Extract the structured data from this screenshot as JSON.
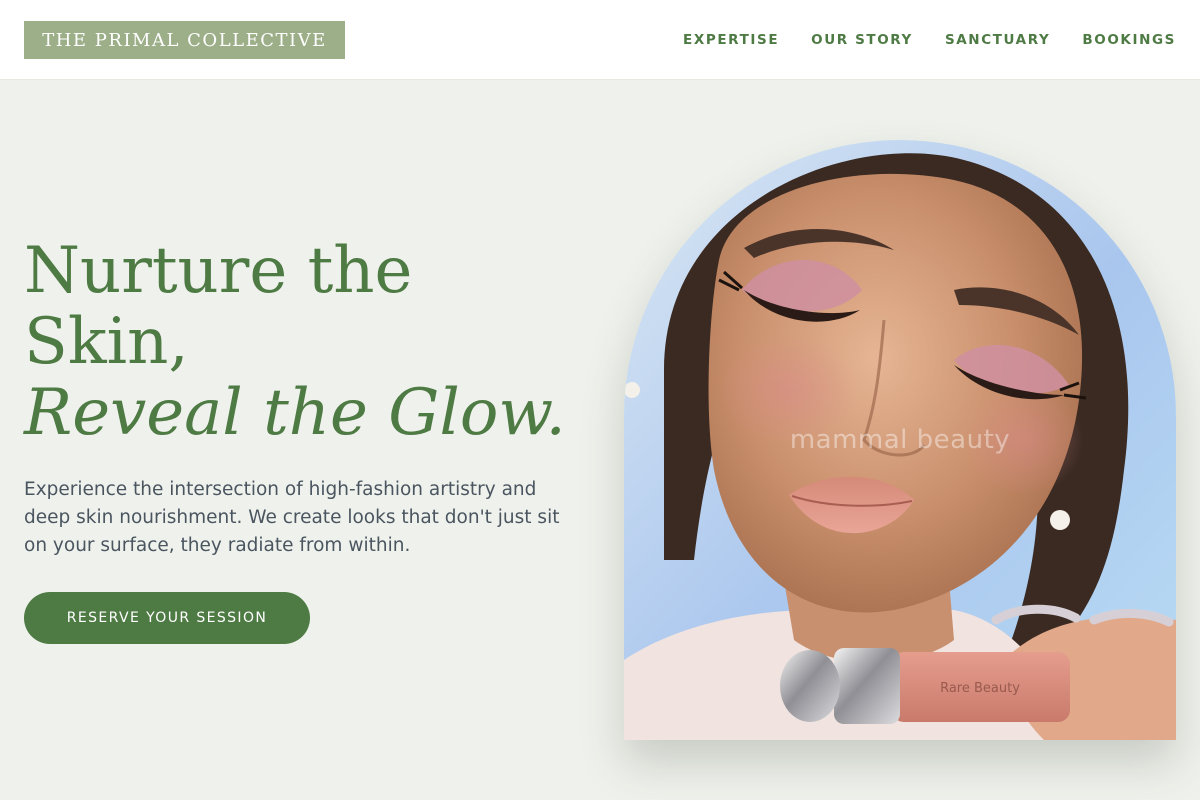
{
  "brand": {
    "logo_text": "THE PRIMAL COLLECTIVE"
  },
  "nav": {
    "items": [
      {
        "label": "EXPERTISE"
      },
      {
        "label": "OUR STORY"
      },
      {
        "label": "SANCTUARY"
      },
      {
        "label": "BOOKINGS"
      }
    ]
  },
  "hero": {
    "headline_line1": "Nurture the",
    "headline_line2": "Skin,",
    "headline_line3": "Reveal the Glow.",
    "subtext": "Experience the intersection of high-fashion artistry and deep skin nourishment. We create looks that don't just sit on your surface, they radiate from within.",
    "cta_label": "RESERVE YOUR SESSION",
    "image": {
      "watermark": "mammal beauty",
      "product_label": "Rare Beauty"
    }
  },
  "colors": {
    "accent": "#4e7a44",
    "logo_bg": "#9daf88",
    "page_bg": "#eff2ec",
    "header_bg": "#ffffff",
    "body_text": "#4a5560"
  }
}
